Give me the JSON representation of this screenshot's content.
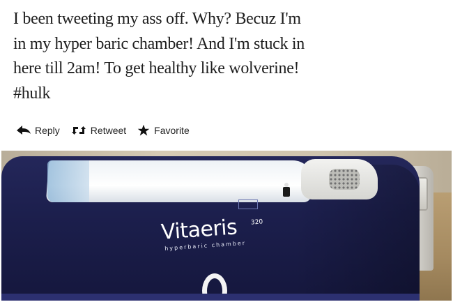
{
  "tweet": {
    "text": "I been tweeting my ass off. Why? Becuz I'm\nin my hyper baric chamber! And I'm stuck in\nhere till 2am! To get healthy like wolverine!\n#hulk"
  },
  "actions": {
    "reply": {
      "label": "Reply",
      "icon": "reply-arrow-icon"
    },
    "retweet": {
      "label": "Retweet",
      "icon": "retweet-icon"
    },
    "favorite": {
      "label": "Favorite",
      "icon": "star-icon"
    }
  },
  "photo": {
    "brand_name": "Vitaeris",
    "brand_model": "320",
    "brand_subtitle": "hyperbaric chamber"
  },
  "colors": {
    "text": "#1e1e1e",
    "chamber_cover": "#1c1f4d",
    "action_text": "#222222"
  }
}
